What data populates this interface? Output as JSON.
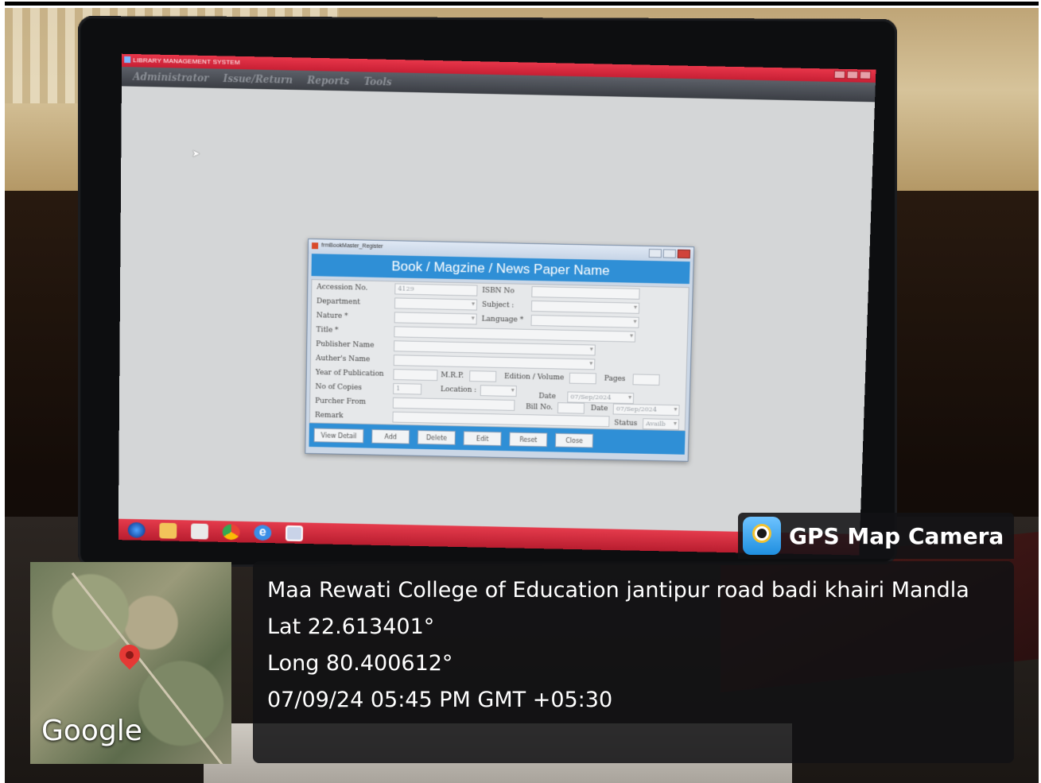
{
  "app": {
    "window_title": "LIBRARY MANAGEMENT SYSTEM",
    "menu": [
      "Administrator",
      "Issue/Return",
      "Reports",
      "Tools"
    ]
  },
  "dialog": {
    "window_title": "frmBookMaster_Register",
    "banner": "Book / Magzine / News Paper Name",
    "labels": {
      "accession": "Accession No.",
      "department": "Department",
      "nature": "Nature *",
      "title": "Title *",
      "publisher": "Publisher Name",
      "author": "Auther's Name",
      "year": "Year of Publication",
      "copies": "No of Copies",
      "purchased_from": "Purcher From",
      "remark": "Remark",
      "isbn": "ISBN No",
      "subject": "Subject :",
      "language": "Language *",
      "mrp": "M.R.P.",
      "edition": "Edition / Volume",
      "pages": "Pages",
      "location": "Location :",
      "date": "Date",
      "bill_no": "Bill No.",
      "bill_date": "Date",
      "status": "Status"
    },
    "values": {
      "accession": "4129",
      "copies": "1",
      "date": "07/Sep/2024",
      "bill_date": "07/Sep/2024",
      "status": "Availb"
    },
    "buttons": [
      "View Detail",
      "Add",
      "Delete",
      "Edit",
      "Reset",
      "Close"
    ]
  },
  "overlay": {
    "badge": "GPS Map Camera",
    "location": "Maa Rewati College of Education jantipur road badi khairi Mandla",
    "lat": "Lat 22.613401°",
    "long": "Long 80.400612°",
    "datetime": "07/09/24 05:45 PM GMT +05:30",
    "map_brand": "Google"
  }
}
